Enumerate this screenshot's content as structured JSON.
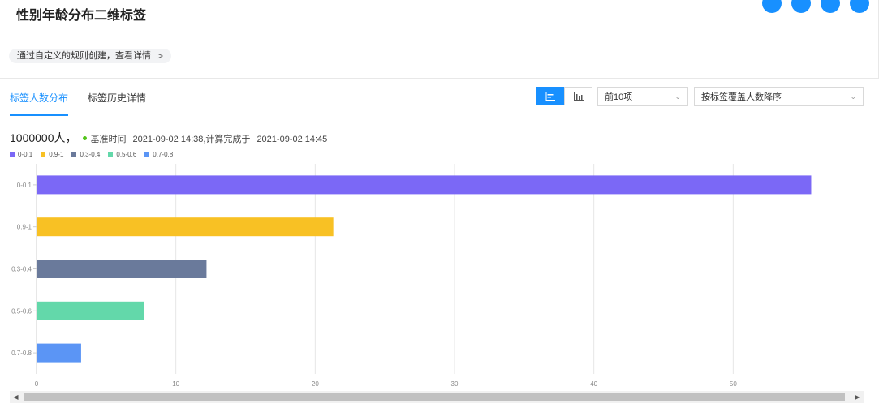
{
  "header": {
    "title": "性别年龄分布二维标签",
    "rule_link": "通过自定义的规则创建，查看详情",
    "rule_chevron": ">"
  },
  "tabs": [
    {
      "label": "标签人数分布",
      "active": true
    },
    {
      "label": "标签历史详情",
      "active": false
    }
  ],
  "toolbar": {
    "view_bar_icon": "horizontal-bar-icon",
    "view_column_icon": "column-chart-icon",
    "top_select": "前10项",
    "sort_select": "按标签覆盖人数降序"
  },
  "summary": {
    "total": "1000000人，",
    "baseline_label": "基准时间",
    "baseline_time": "2021-09-02 14:38,计算完成于",
    "completed_time": "2021-09-02 14:45"
  },
  "colors": {
    "accent": "#1890ff",
    "status_dot": "#52c41a"
  },
  "chart_data": {
    "type": "bar",
    "orientation": "horizontal",
    "categories": [
      "0-0.1",
      "0.9-1",
      "0.3-0.4",
      "0.5-0.6",
      "0.7-0.8"
    ],
    "values": [
      55.6,
      21.3,
      12.2,
      7.7,
      3.2
    ],
    "colors": [
      "#7b68f6",
      "#f8c124",
      "#6a7a9b",
      "#63d8aa",
      "#5b95f5"
    ],
    "legend": [
      "0-0.1",
      "0.9-1",
      "0.3-0.4",
      "0.5-0.6",
      "0.7-0.8"
    ],
    "legend_position": "top-left",
    "xlim": [
      0,
      60
    ],
    "xticks": [
      0,
      10,
      20,
      30,
      40,
      50
    ],
    "grid": true
  }
}
